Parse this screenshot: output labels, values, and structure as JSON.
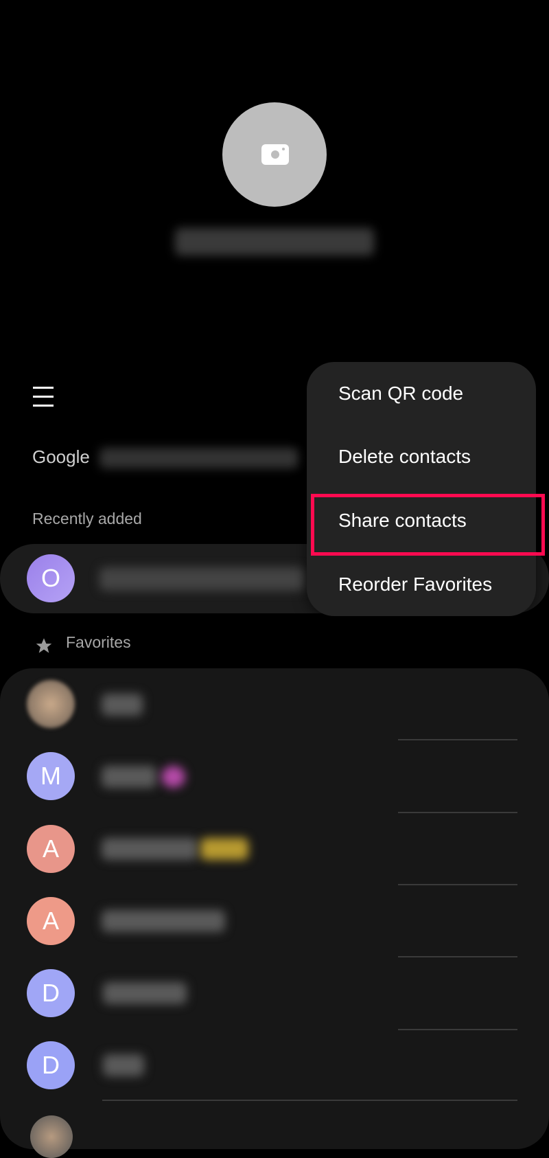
{
  "profile": {
    "photo_icon": "camera-icon"
  },
  "toolbar": {
    "menu_icon": "hamburger-icon"
  },
  "account": {
    "label": "Google"
  },
  "recently_added": {
    "label": "Recently added",
    "contacts": [
      {
        "initial": "O",
        "color": "#a58cf0"
      }
    ]
  },
  "favorites": {
    "label": "Favorites",
    "icon": "star-icon",
    "contacts": [
      {
        "initial": "",
        "color": "#8a7a6a"
      },
      {
        "initial": "M",
        "color": "#a5a8f5"
      },
      {
        "initial": "A",
        "color": "#e8968a"
      },
      {
        "initial": "A",
        "color": "#ee9a88"
      },
      {
        "initial": "D",
        "color": "#a0a6f6"
      },
      {
        "initial": "D",
        "color": "#9aa2f6"
      }
    ]
  },
  "menu": {
    "items": [
      {
        "label": "Scan QR code"
      },
      {
        "label": "Delete contacts"
      },
      {
        "label": "Share contacts",
        "highlighted": true
      },
      {
        "label": "Reorder Favorites"
      }
    ],
    "highlight_color": "#ff0a50"
  }
}
